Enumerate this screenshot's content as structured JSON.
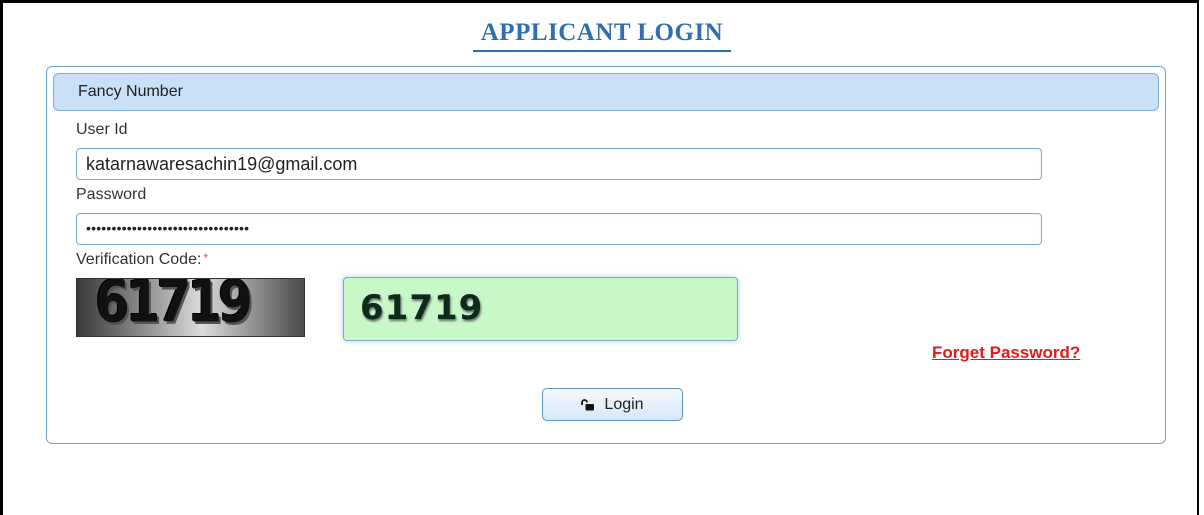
{
  "page": {
    "title": "APPLICANT LOGIN"
  },
  "panel": {
    "header": "Fancy Number"
  },
  "form": {
    "user_id_label": "User Id",
    "user_id_value": "katarnawaresachin19@gmail.com",
    "password_label": "Password",
    "password_value": "••••••••••••••••••••••••••••••••",
    "verification_label": "Verification Code:",
    "required_marker": "*",
    "captcha_image_text": "61719",
    "captcha_input_value": "61719",
    "forget_password_link": "Forget Password?",
    "login_button_label": "Login"
  },
  "colors": {
    "title": "#2f6fb1",
    "panel_header_bg": "#c9e0f7",
    "captcha_input_bg": "#c8f7c8",
    "link": "#e31b1b",
    "required": "#e0453a"
  },
  "icons": {
    "login_button": "unlock-icon"
  }
}
